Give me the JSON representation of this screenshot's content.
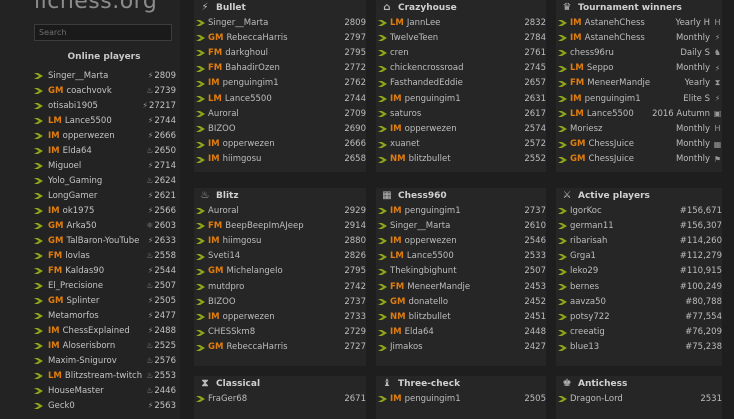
{
  "app": {
    "logo": "lichess.org"
  },
  "search": {
    "placeholder": "Search"
  },
  "online": {
    "title": "Online players",
    "players": [
      {
        "title": "",
        "name": "Singer__Marta",
        "rating": "2809",
        "icon": "bolt"
      },
      {
        "title": "GM",
        "name": "coachvovk",
        "rating": "2739",
        "icon": "fire"
      },
      {
        "title": "",
        "name": "otisabi1905",
        "rating": "27217",
        "icon": "bolt"
      },
      {
        "title": "LM",
        "name": "Lance5500",
        "rating": "2744",
        "icon": "bolt"
      },
      {
        "title": "IM",
        "name": "opperwezen",
        "rating": "2666",
        "icon": "bolt"
      },
      {
        "title": "IM",
        "name": "Elda64",
        "rating": "2650",
        "icon": "fire"
      },
      {
        "title": "",
        "name": "Miguoel",
        "rating": "2714",
        "icon": "bolt"
      },
      {
        "title": "",
        "name": "Yolo_Gaming",
        "rating": "2624",
        "icon": "fire"
      },
      {
        "title": "",
        "name": "LongGamer",
        "rating": "2621",
        "icon": "bolt"
      },
      {
        "title": "IM",
        "name": "ok1975",
        "rating": "2566",
        "icon": "bolt"
      },
      {
        "title": "GM",
        "name": "Arka50",
        "rating": "2603",
        "icon": "atom"
      },
      {
        "title": "GM",
        "name": "TalBaron-YouTube",
        "rating": "2633",
        "icon": "bolt"
      },
      {
        "title": "FM",
        "name": "lovlas",
        "rating": "2558",
        "icon": "fire"
      },
      {
        "title": "FM",
        "name": "Kaldas90",
        "rating": "2544",
        "icon": "bolt"
      },
      {
        "title": "",
        "name": "El_Precisione",
        "rating": "2507",
        "icon": "fire"
      },
      {
        "title": "GM",
        "name": "Splinter",
        "rating": "2505",
        "icon": "bolt"
      },
      {
        "title": "",
        "name": "Metamorfos",
        "rating": "2477",
        "icon": "bolt"
      },
      {
        "title": "IM",
        "name": "ChessExplained",
        "rating": "2488",
        "icon": "bolt"
      },
      {
        "title": "IM",
        "name": "Aloserisborn",
        "rating": "2525",
        "icon": "fire"
      },
      {
        "title": "",
        "name": "Maxim-Snigurov",
        "rating": "2576",
        "icon": "fire"
      },
      {
        "title": "LM",
        "name": "Blitzstream-twitch",
        "rating": "2553",
        "icon": "fire"
      },
      {
        "title": "",
        "name": "HouseMaster",
        "rating": "2446",
        "icon": "fire"
      },
      {
        "title": "",
        "name": "Geck0",
        "rating": "2563",
        "icon": "bolt"
      }
    ]
  },
  "panels": {
    "bullet": {
      "title": "Bullet",
      "icon": "bullet-icon",
      "glyph": "⚡",
      "rows": [
        {
          "title": "",
          "name": "Singer__Marta",
          "val": "2809"
        },
        {
          "title": "GM",
          "name": "RebeccaHarris",
          "val": "2797"
        },
        {
          "title": "FM",
          "name": "darkghoul",
          "val": "2795"
        },
        {
          "title": "FM",
          "name": "BahadirOzen",
          "val": "2772"
        },
        {
          "title": "IM",
          "name": "penguingim1",
          "val": "2762"
        },
        {
          "title": "LM",
          "name": "Lance5500",
          "val": "2744"
        },
        {
          "title": "",
          "name": "Auroral",
          "val": "2709"
        },
        {
          "title": "",
          "name": "BIZOO",
          "val": "2690"
        },
        {
          "title": "IM",
          "name": "opperwezen",
          "val": "2666"
        },
        {
          "title": "IM",
          "name": "hiimgosu",
          "val": "2658"
        }
      ]
    },
    "crazyhouse": {
      "title": "Crazyhouse",
      "icon": "crazyhouse-icon",
      "glyph": "⌂",
      "rows": [
        {
          "title": "LM",
          "name": "JannLee",
          "val": "2832"
        },
        {
          "title": "",
          "name": "TwelveTeen",
          "val": "2784"
        },
        {
          "title": "",
          "name": "cren",
          "val": "2761"
        },
        {
          "title": "",
          "name": "chickencrossroad",
          "val": "2745"
        },
        {
          "title": "",
          "name": "FasthandedEddie",
          "val": "2657"
        },
        {
          "title": "IM",
          "name": "penguingim1",
          "val": "2631"
        },
        {
          "title": "",
          "name": "saturos",
          "val": "2617"
        },
        {
          "title": "IM",
          "name": "opperwezen",
          "val": "2574"
        },
        {
          "title": "",
          "name": "xuanet",
          "val": "2572"
        },
        {
          "title": "NM",
          "name": "blitzbullet",
          "val": "2552"
        }
      ]
    },
    "tournament": {
      "title": "Tournament winners",
      "icon": "trophy-icon",
      "glyph": "♛",
      "rows": [
        {
          "title": "IM",
          "name": "AstanehChess",
          "val": "Yearly H",
          "ticon": "H"
        },
        {
          "title": "IM",
          "name": "AstanehChess",
          "val": "Monthly",
          "ticon": "⚡"
        },
        {
          "title": "",
          "name": "chess96ru",
          "val": "Daily S",
          "ticon": "♞"
        },
        {
          "title": "LM",
          "name": "Seppo",
          "val": "Monthly",
          "ticon": "⚡"
        },
        {
          "title": "FM",
          "name": "MeneerMandje",
          "val": "Yearly",
          "ticon": "⧗"
        },
        {
          "title": "IM",
          "name": "penguingim1",
          "val": "Elite S",
          "ticon": "⚡"
        },
        {
          "title": "LM",
          "name": "Lance5500",
          "val": "2016 Autumn",
          "ticon": "▣"
        },
        {
          "title": "",
          "name": "Moriesz",
          "val": "Monthly",
          "ticon": "H"
        },
        {
          "title": "GM",
          "name": "ChessJuice",
          "val": "Monthly",
          "ticon": "▦"
        },
        {
          "title": "GM",
          "name": "ChessJuice",
          "val": "Monthly",
          "ticon": "⚑"
        }
      ]
    },
    "blitz": {
      "title": "Blitz",
      "icon": "blitz-icon",
      "glyph": "♨",
      "rows": [
        {
          "title": "",
          "name": "Auroral",
          "val": "2929"
        },
        {
          "title": "FM",
          "name": "BeepBeepImAJeep",
          "val": "2914"
        },
        {
          "title": "IM",
          "name": "hiimgosu",
          "val": "2880"
        },
        {
          "title": "",
          "name": "Sveti14",
          "val": "2826"
        },
        {
          "title": "GM",
          "name": "MichelangeIo",
          "val": "2795"
        },
        {
          "title": "",
          "name": "mutdpro",
          "val": "2742"
        },
        {
          "title": "",
          "name": "BIZOO",
          "val": "2737"
        },
        {
          "title": "IM",
          "name": "opperwezen",
          "val": "2733"
        },
        {
          "title": "",
          "name": "CHESSkm8",
          "val": "2729"
        },
        {
          "title": "GM",
          "name": "RebeccaHarris",
          "val": "2727"
        }
      ]
    },
    "chess960": {
      "title": "Chess960",
      "icon": "chess960-icon",
      "glyph": "▦",
      "rows": [
        {
          "title": "IM",
          "name": "penguingim1",
          "val": "2737"
        },
        {
          "title": "",
          "name": "Singer__Marta",
          "val": "2610"
        },
        {
          "title": "IM",
          "name": "opperwezen",
          "val": "2546"
        },
        {
          "title": "LM",
          "name": "Lance5500",
          "val": "2533"
        },
        {
          "title": "",
          "name": "Thekingbighunt",
          "val": "2507"
        },
        {
          "title": "FM",
          "name": "MeneerMandje",
          "val": "2453"
        },
        {
          "title": "GM",
          "name": "donatello",
          "val": "2452"
        },
        {
          "title": "NM",
          "name": "blitzbullet",
          "val": "2451"
        },
        {
          "title": "IM",
          "name": "Elda64",
          "val": "2448"
        },
        {
          "title": "",
          "name": "Jimakos",
          "val": "2427"
        }
      ]
    },
    "active": {
      "title": "Active players",
      "icon": "crossed-swords-icon",
      "glyph": "⚔",
      "rows": [
        {
          "title": "",
          "name": "IgorKoc",
          "val": "#156,671"
        },
        {
          "title": "",
          "name": "german11",
          "val": "#156,307"
        },
        {
          "title": "",
          "name": "ribarisah",
          "val": "#114,260"
        },
        {
          "title": "",
          "name": "Grga1",
          "val": "#112,279"
        },
        {
          "title": "",
          "name": "leko29",
          "val": "#110,915"
        },
        {
          "title": "",
          "name": "bernes",
          "val": "#100,249"
        },
        {
          "title": "",
          "name": "aavza50",
          "val": "#80,788"
        },
        {
          "title": "",
          "name": "potsy722",
          "val": "#77,554"
        },
        {
          "title": "",
          "name": "creeatig",
          "val": "#76,209"
        },
        {
          "title": "",
          "name": "blue13",
          "val": "#75,238"
        }
      ]
    },
    "classical": {
      "title": "Classical",
      "icon": "classical-icon",
      "glyph": "⧗",
      "rows": [
        {
          "title": "",
          "name": "FraGer68",
          "val": "2671"
        }
      ]
    },
    "threecheck": {
      "title": "Three-check",
      "icon": "three-check-icon",
      "glyph": "♝",
      "rows": [
        {
          "title": "IM",
          "name": "penguingim1",
          "val": "2505"
        }
      ]
    },
    "antichess": {
      "title": "Antichess",
      "icon": "antichess-icon",
      "glyph": "♚",
      "rows": [
        {
          "title": "",
          "name": "Dragon-Lord",
          "val": "2531"
        }
      ]
    }
  },
  "colors": {
    "title": "#e07d10",
    "online_dot": "#8ea71a",
    "bg": "#1e1e1e",
    "panel": "#262626"
  }
}
